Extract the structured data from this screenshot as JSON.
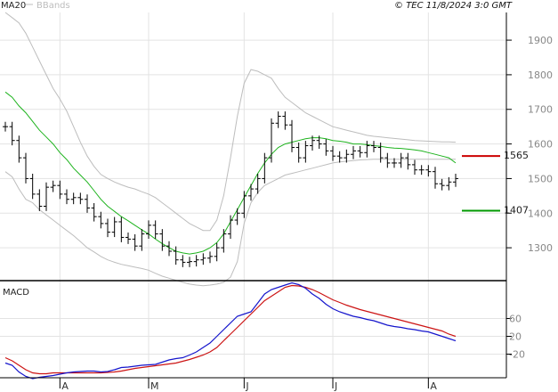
{
  "header": {
    "legend_ma": "MA20",
    "legend_bb": "BBands",
    "copyright": "© TEC 11/8/2024 3:0 GMT"
  },
  "macd_panel": {
    "label": "MACD"
  },
  "colors": {
    "ma": "#1db31d",
    "bbands": "#bdbdbd",
    "price": "#000000",
    "macd": "#1515cc",
    "signal": "#cc1414",
    "resistance": "#cc0000",
    "support": "#009900",
    "grid": "#e3e3e3",
    "frame": "#000000"
  },
  "levels": {
    "resistance": {
      "value": 1565,
      "label": "1565"
    },
    "support": {
      "value": 1407,
      "label": "1407"
    }
  },
  "chart_data": [
    {
      "type": "line",
      "title": "",
      "xlabel": "",
      "ylabel": "",
      "x_tick_labels": [
        "A",
        "M",
        "J",
        "J",
        "A"
      ],
      "x_tick_index": [
        8,
        21,
        35,
        48,
        62
      ],
      "y_ticks": [
        1300,
        1400,
        1500,
        1600,
        1700,
        1800,
        1900
      ],
      "ylim": [
        1205,
        1980
      ],
      "grid": true,
      "legend": "top-left",
      "n_bars": 67,
      "ohlc_close": [
        1650,
        1610,
        1560,
        1500,
        1455,
        1420,
        1475,
        1480,
        1455,
        1440,
        1445,
        1440,
        1415,
        1390,
        1370,
        1345,
        1375,
        1330,
        1325,
        1305,
        1340,
        1365,
        1340,
        1305,
        1290,
        1265,
        1258,
        1260,
        1265,
        1270,
        1275,
        1300,
        1340,
        1380,
        1400,
        1450,
        1470,
        1500,
        1560,
        1660,
        1680,
        1655,
        1590,
        1560,
        1595,
        1610,
        1600,
        1580,
        1565,
        1560,
        1570,
        1580,
        1575,
        1595,
        1590,
        1560,
        1545,
        1545,
        1560,
        1540,
        1525,
        1525,
        1520,
        1485,
        1480,
        1490,
        1500
      ],
      "series": [
        {
          "name": "MA20",
          "values": [
            1750,
            1735,
            1710,
            1690,
            1665,
            1640,
            1620,
            1600,
            1575,
            1555,
            1530,
            1510,
            1490,
            1465,
            1440,
            1420,
            1405,
            1390,
            1378,
            1365,
            1352,
            1340,
            1325,
            1312,
            1300,
            1290,
            1285,
            1282,
            1285,
            1290,
            1300,
            1315,
            1340,
            1375,
            1410,
            1445,
            1480,
            1515,
            1545,
            1570,
            1590,
            1600,
            1605,
            1610,
            1615,
            1618,
            1618,
            1615,
            1610,
            1608,
            1605,
            1600,
            1600,
            1598,
            1595,
            1593,
            1590,
            1588,
            1587,
            1585,
            1583,
            1580,
            1575,
            1570,
            1565,
            1560,
            1545
          ]
        },
        {
          "name": "BBands upper",
          "values": [
            1980,
            1965,
            1950,
            1920,
            1880,
            1840,
            1800,
            1760,
            1730,
            1695,
            1650,
            1605,
            1565,
            1535,
            1512,
            1500,
            1490,
            1482,
            1475,
            1470,
            1462,
            1455,
            1445,
            1430,
            1415,
            1400,
            1385,
            1370,
            1360,
            1350,
            1350,
            1380,
            1450,
            1560,
            1680,
            1775,
            1815,
            1810,
            1800,
            1790,
            1760,
            1735,
            1720,
            1705,
            1690,
            1680,
            1670,
            1660,
            1650,
            1645,
            1640,
            1635,
            1630,
            1625,
            1622,
            1620,
            1618,
            1616,
            1614,
            1612,
            1610,
            1609,
            1608,
            1607,
            1606,
            1606,
            1605
          ]
        },
        {
          "name": "BBands lower",
          "values": [
            1520,
            1505,
            1470,
            1440,
            1430,
            1410,
            1395,
            1380,
            1365,
            1350,
            1335,
            1318,
            1300,
            1288,
            1275,
            1265,
            1258,
            1252,
            1248,
            1244,
            1240,
            1235,
            1226,
            1218,
            1212,
            1206,
            1200,
            1195,
            1192,
            1190,
            1192,
            1195,
            1200,
            1215,
            1260,
            1370,
            1430,
            1460,
            1480,
            1490,
            1500,
            1510,
            1515,
            1520,
            1525,
            1530,
            1535,
            1540,
            1545,
            1548,
            1550,
            1552,
            1554,
            1555,
            1556,
            1556,
            1556,
            1556,
            1556,
            1556,
            1556,
            1556,
            1556,
            1556,
            1556,
            1556,
            1556
          ]
        }
      ]
    },
    {
      "type": "line",
      "title": "",
      "y_ticks": [
        60,
        20,
        -20
      ],
      "y_tick_labels": [
        "60",
        "20",
        "-20"
      ],
      "ylim": [
        -73,
        145
      ],
      "series": [
        {
          "name": "MACD",
          "values": [
            -40,
            -45,
            -60,
            -70,
            -75,
            -72,
            -70,
            -68,
            -65,
            -62,
            -60,
            -59,
            -58,
            -58,
            -60,
            -59,
            -55,
            -50,
            -49,
            -47,
            -45,
            -44,
            -43,
            -38,
            -33,
            -30,
            -28,
            -22,
            -15,
            -5,
            5,
            20,
            35,
            50,
            65,
            70,
            75,
            95,
            115,
            125,
            130,
            135,
            140,
            136,
            128,
            115,
            105,
            92,
            82,
            75,
            70,
            65,
            62,
            58,
            55,
            50,
            45,
            42,
            40,
            37,
            35,
            32,
            30,
            25,
            20,
            15,
            10
          ]
        },
        {
          "name": "Signal",
          "values": [
            -28,
            -35,
            -45,
            -55,
            -62,
            -64,
            -64,
            -62,
            -62,
            -62,
            -62,
            -62,
            -62,
            -62,
            -62,
            -61,
            -60,
            -58,
            -55,
            -52,
            -50,
            -48,
            -46,
            -44,
            -42,
            -40,
            -36,
            -32,
            -27,
            -22,
            -15,
            -5,
            10,
            25,
            40,
            55,
            70,
            85,
            100,
            110,
            120,
            130,
            134,
            133,
            130,
            125,
            118,
            110,
            102,
            96,
            90,
            85,
            80,
            76,
            72,
            68,
            64,
            60,
            56,
            52,
            48,
            44,
            40,
            36,
            32,
            25,
            20
          ]
        }
      ]
    }
  ]
}
